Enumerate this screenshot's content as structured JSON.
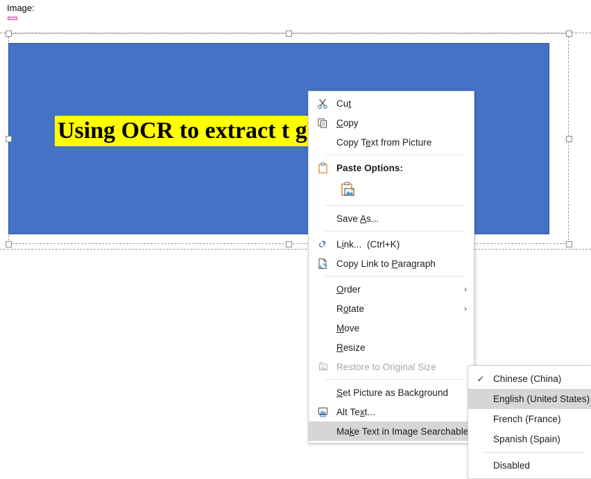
{
  "document": {
    "label": "Image:",
    "picture": {
      "caption_text": "Using OCR to extract t                    ges",
      "caption_full": "Using OCR to extract text from images",
      "background_color": "#4472C4",
      "highlight_color": "#FFFF00"
    }
  },
  "context_menu": {
    "items": [
      {
        "id": "cut",
        "label": "Cut",
        "icon": "scissors-icon",
        "accel_index": 2
      },
      {
        "id": "copy",
        "label": "Copy",
        "icon": "copy-icon",
        "accel_index": 0
      },
      {
        "id": "copy-text-from-picture",
        "label": "Copy Text from Picture",
        "icon": "none",
        "accel_index": 7
      },
      {
        "id": "separator-1",
        "type": "separator"
      },
      {
        "id": "paste-options",
        "label": "Paste Options:",
        "icon": "clipboard-icon",
        "bold": true
      },
      {
        "id": "paste-picture-button",
        "type": "gallery",
        "icon": "paste-picture-icon"
      },
      {
        "id": "separator-2",
        "type": "separator"
      },
      {
        "id": "save-as",
        "label": "Save As...",
        "icon": "none",
        "accel_index": 5
      },
      {
        "id": "separator-3",
        "type": "separator"
      },
      {
        "id": "link",
        "label": "Link...  (Ctrl+K)",
        "icon": "link-icon",
        "accel_index": 1
      },
      {
        "id": "copy-link-to-paragraph",
        "label": "Copy Link to Paragraph",
        "icon": "copy-link-icon",
        "accel_index": 13
      },
      {
        "id": "separator-4",
        "type": "separator"
      },
      {
        "id": "order",
        "label": "Order",
        "icon": "none",
        "accel_index": 0,
        "arrow": true
      },
      {
        "id": "rotate",
        "label": "Rotate",
        "icon": "none",
        "accel_index": 1,
        "arrow": true
      },
      {
        "id": "move",
        "label": "Move",
        "icon": "none",
        "accel_index": 0
      },
      {
        "id": "resize",
        "label": "Resize",
        "icon": "none",
        "accel_index": 0
      },
      {
        "id": "restore-to-original-size",
        "label": "Restore to Original Size",
        "icon": "restore-size-icon",
        "disabled": true
      },
      {
        "id": "separator-5",
        "type": "separator"
      },
      {
        "id": "set-picture-as-background",
        "label": "Set Picture as Background",
        "icon": "none",
        "accel_index": 0
      },
      {
        "id": "alt-text",
        "label": "Alt Text...",
        "icon": "alt-text-icon",
        "accel_index": 6
      },
      {
        "id": "make-text-in-image-searchable",
        "label": "Make Text in Image Searchable",
        "icon": "none",
        "accel_index": 3,
        "arrow": true,
        "highlighted": true
      }
    ],
    "arrow_glyph": "›"
  },
  "language_submenu": {
    "check_glyph": "✓",
    "items": [
      {
        "id": "chinese-china",
        "label": "Chinese (China)",
        "checked": true
      },
      {
        "id": "english-united-states",
        "label": "English (United States)",
        "highlighted": true
      },
      {
        "id": "french-france",
        "label": "French (France)"
      },
      {
        "id": "spanish-spain",
        "label": "Spanish (Spain)"
      },
      {
        "id": "separator-lang",
        "type": "separator"
      },
      {
        "id": "disabled",
        "label": "Disabled"
      }
    ]
  },
  "selection": {
    "handle_count": 8
  }
}
